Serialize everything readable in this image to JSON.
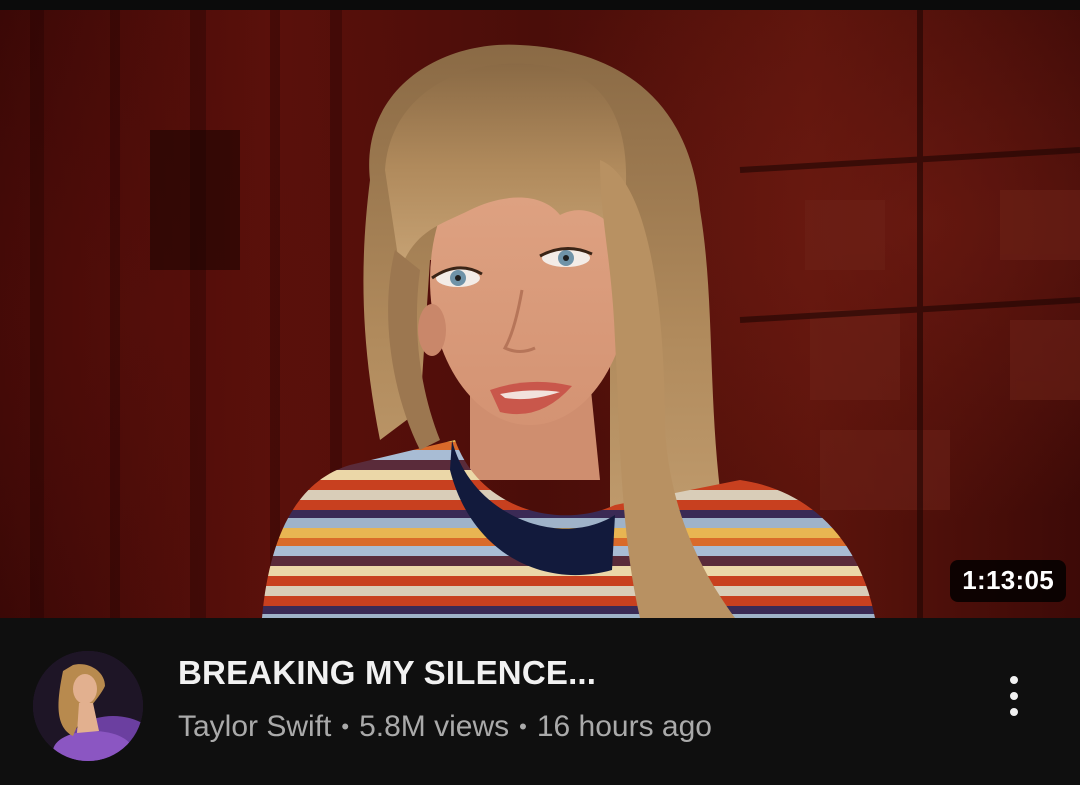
{
  "video": {
    "duration": "1:13:05",
    "title": "BREAKING MY SILENCE...",
    "channel": "Taylor Swift",
    "views": "5.8M views",
    "age": "16 hours ago",
    "separator": "•"
  },
  "icons": {
    "more": "more-vert-icon"
  },
  "colors": {
    "background": "#0f0f0f",
    "title": "#f1f1f1",
    "meta": "#aaaaaa",
    "badge_bg": "#000000"
  }
}
